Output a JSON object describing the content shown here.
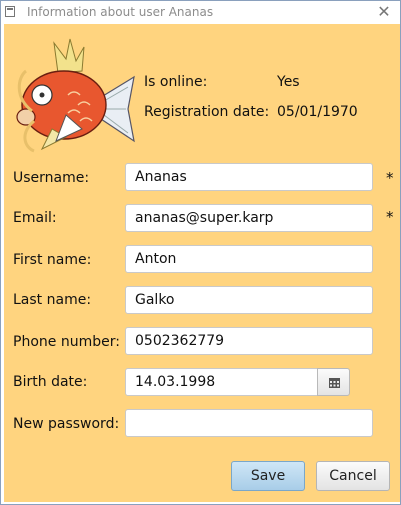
{
  "window": {
    "title": "Information about user Ananas",
    "close_glyph": "✕"
  },
  "status": {
    "online_label": "Is online:",
    "online_value": "Yes",
    "registration_label": "Registration date:",
    "registration_value": "05/01/1970"
  },
  "form": {
    "username": {
      "label": "Username:",
      "value": "Ananas",
      "required_mark": "*"
    },
    "email": {
      "label": "Email:",
      "value": "ananas@super.karp",
      "required_mark": "*"
    },
    "first_name": {
      "label": "First name:",
      "value": "Anton"
    },
    "last_name": {
      "label": "Last name:",
      "value": "Galko"
    },
    "phone": {
      "label": "Phone number:",
      "value": "0502362779"
    },
    "birth_date": {
      "label": "Birth date:",
      "value": "14.03.1998",
      "picker_icon": "calendar-icon"
    },
    "new_password": {
      "label": "New password:",
      "value": ""
    }
  },
  "buttons": {
    "save_label": "Save",
    "cancel_label": "Cancel"
  },
  "colors": {
    "background": "#ffd47f",
    "save_button": "#b8d8ef"
  },
  "avatar_icon": "magikarp-avatar"
}
